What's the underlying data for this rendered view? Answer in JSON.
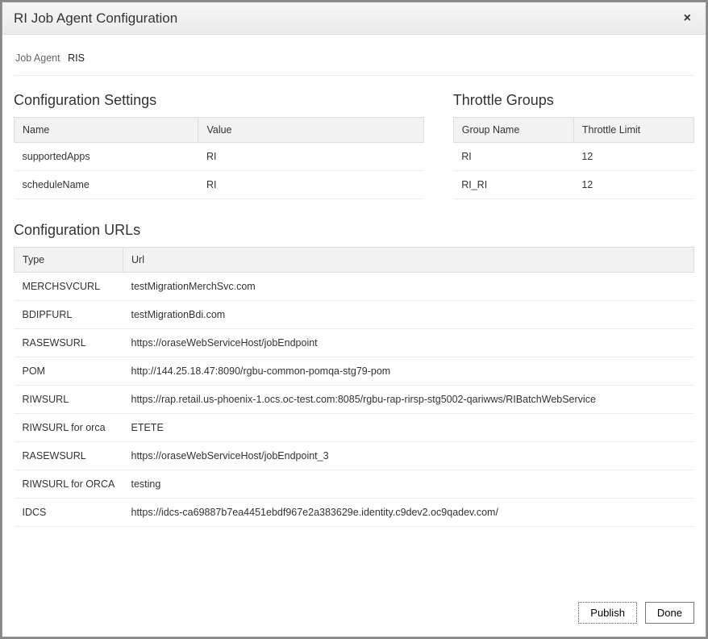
{
  "header": {
    "title": "RI Job Agent Configuration",
    "close_label": "×"
  },
  "job_agent": {
    "label": "Job Agent",
    "value": "RIS"
  },
  "config_settings": {
    "title": "Configuration Settings",
    "columns": {
      "name": "Name",
      "value": "Value"
    },
    "rows": [
      {
        "name": "supportedApps",
        "value": "RI"
      },
      {
        "name": "scheduleName",
        "value": "RI"
      }
    ]
  },
  "throttle_groups": {
    "title": "Throttle Groups",
    "columns": {
      "group_name": "Group Name",
      "throttle_limit": "Throttle Limit"
    },
    "rows": [
      {
        "group_name": "RI",
        "throttle_limit": "12"
      },
      {
        "group_name": "RI_RI",
        "throttle_limit": "12"
      }
    ]
  },
  "config_urls": {
    "title": "Configuration URLs",
    "columns": {
      "type": "Type",
      "url": "Url"
    },
    "rows": [
      {
        "type": "MERCHSVCURL",
        "url": "testMigrationMerchSvc.com"
      },
      {
        "type": "BDIPFURL",
        "url": "testMigrationBdi.com"
      },
      {
        "type": "RASEWSURL",
        "url": "https://oraseWebServiceHost/jobEndpoint"
      },
      {
        "type": "POM",
        "url": "http://144.25.18.47:8090/rgbu-common-pomqa-stg79-pom"
      },
      {
        "type": "RIWSURL",
        "url": "https://rap.retail.us-phoenix-1.ocs.oc-test.com:8085/rgbu-rap-rirsp-stg5002-qariwws/RIBatchWebService"
      },
      {
        "type": "RIWSURL for orca",
        "url": "ETETE"
      },
      {
        "type": "RASEWSURL",
        "url": "https://oraseWebServiceHost/jobEndpoint_3"
      },
      {
        "type": "RIWSURL for ORCA",
        "url": "testing"
      },
      {
        "type": "IDCS",
        "url": "https://idcs-ca69887b7ea4451ebdf967e2a383629e.identity.c9dev2.oc9qadev.com/"
      }
    ]
  },
  "footer": {
    "publish": "Publish",
    "done": "Done"
  }
}
